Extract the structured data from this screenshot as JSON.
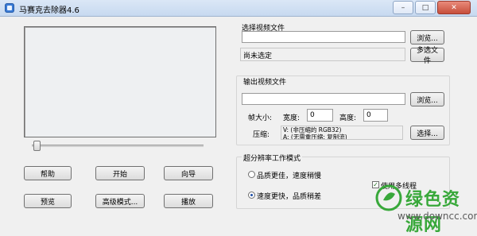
{
  "window": {
    "title": "马赛克去除器4.6",
    "minimize_glyph": "–",
    "maximize_glyph": "□",
    "close_glyph": "✕"
  },
  "buttons": {
    "help": "帮助",
    "start": "开始",
    "wizard": "向导",
    "preview": "预览",
    "advanced": "高级模式...",
    "play": "播放"
  },
  "input_section": {
    "label": "选择视频文件",
    "value": "",
    "browse_label": "浏览...",
    "status_text": "尚未选定",
    "multi_select_label": "多选文件"
  },
  "output_section": {
    "label": "输出视频文件",
    "value": "",
    "browse_label": "浏览...",
    "frame_size_label": "帧大小:",
    "width_label": "宽度:",
    "width_value": "0",
    "height_label": "高度:",
    "height_value": "0",
    "compress_label": "压缩:",
    "codec_line1": "V: (非压缩的 RGB32)",
    "codec_line2": "A: (无需重压缩: 复制流)",
    "choose_label": "选择..."
  },
  "mode_section": {
    "label": "超分辨率工作模式",
    "option_quality": "品质更佳，速度稍慢",
    "option_speed": "速度更快，品质稍差",
    "selected": "speed",
    "multithread_label": "使用多线程",
    "multithread_checked": true
  },
  "watermark": {
    "text": "绿色资源网",
    "url": "www.downcc.com"
  },
  "colors": {
    "titlebar": "#dbe7f6",
    "close_button": "#c64f3c",
    "watermark_green": "#38a83a"
  }
}
